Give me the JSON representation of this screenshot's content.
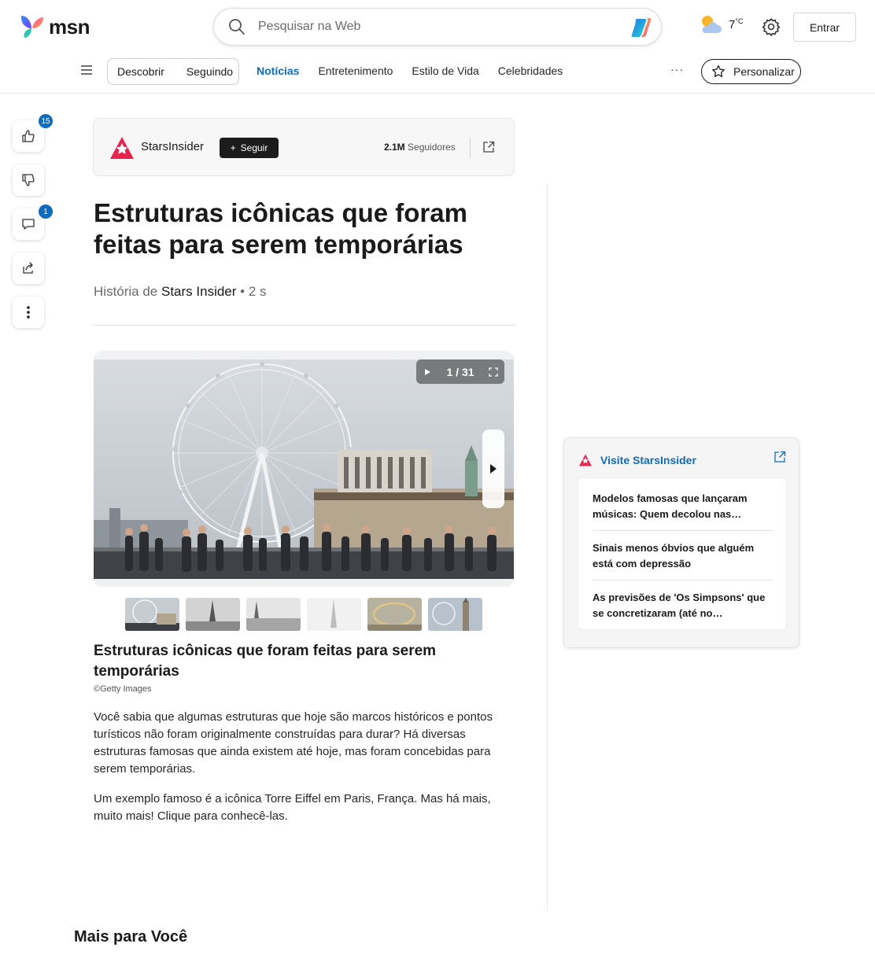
{
  "header": {
    "logo_text": "msn",
    "search_placeholder": "Pesquisar na Web",
    "weather_temp": "7",
    "weather_unit": "°C",
    "signin_label": "Entrar"
  },
  "nav": {
    "pill": [
      "Descobrir",
      "Seguindo"
    ],
    "links": [
      "Notícias",
      "Entretenimento",
      "Estilo de Vida",
      "Celebridades"
    ],
    "more": "···",
    "personalize": "Personalizar"
  },
  "rail": {
    "like_count": "15",
    "comment_count": "1"
  },
  "publisher": {
    "name": "StarsInsider",
    "follow_label": "Seguir",
    "followers_count": "2.1M",
    "followers_label": "Seguidores",
    "brand_color": "#e8254e"
  },
  "article": {
    "title": "Estruturas icônicas que foram feitas para serem temporárias",
    "byline_prefix": "História de",
    "byline_source": "Stars Insider",
    "byline_time": "• 2 s",
    "slide_counter": "1 / 31",
    "caption": "Estruturas icônicas que foram feitas para serem temporárias",
    "credit": "©Getty Images",
    "paragraphs": [
      "Você sabia que algumas estruturas que hoje são marcos históricos e pontos turísticos não foram originalmente construídas para durar? Há diversas estruturas famosas que ainda existem até hoje, mas foram concebidas para serem temporárias.",
      "Um exemplo famoso é a icônica Torre Eiffel em Paris, França. Mas há mais, muito mais! Clique para conhecê-las."
    ]
  },
  "sidebar_card": {
    "title": "Visite StarsInsider",
    "items": [
      "Modelos famosas que lançaram músicas: Quem decolou nas…",
      "Sinais menos óbvios que alguém está com depressão",
      "As previsões de 'Os Simpsons' que se concretizaram (até no…"
    ]
  },
  "footer": {
    "more_for_you": "Mais para Você"
  }
}
